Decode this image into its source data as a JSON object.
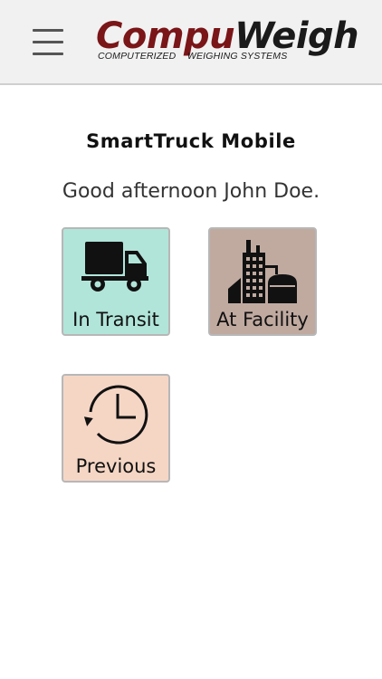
{
  "header": {
    "menu_icon": "hamburger-menu-icon",
    "logo": {
      "part1": "Compu",
      "part2": "Weigh",
      "tagline": "COMPUTERIZED    WEIGHING SYSTEMS",
      "colors": {
        "part1": "#7a1518",
        "part2": "#1a1a1a"
      }
    }
  },
  "main": {
    "title": "SmartTruck Mobile",
    "greeting": "Good afternoon John Doe.",
    "tiles": [
      {
        "label": "In Transit",
        "icon": "truck-icon",
        "color": "#b1e5d9"
      },
      {
        "label": "At Facility",
        "icon": "factory-icon",
        "color": "#c0aaa0"
      },
      {
        "label": "Previous",
        "icon": "history-clock-icon",
        "color": "#f5d6c5"
      }
    ]
  }
}
